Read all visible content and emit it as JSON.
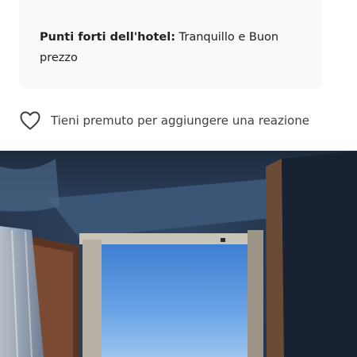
{
  "hotel_highlights": {
    "label": "Punti forti dell'hotel:",
    "value": "Tranquillo e Buon prezzo"
  },
  "reaction": {
    "icon": "heart-outline-icon",
    "text": "Tieni premuto per aggiungere una reazione"
  },
  "photo": {
    "subject": "hotel-room-window-view"
  }
}
